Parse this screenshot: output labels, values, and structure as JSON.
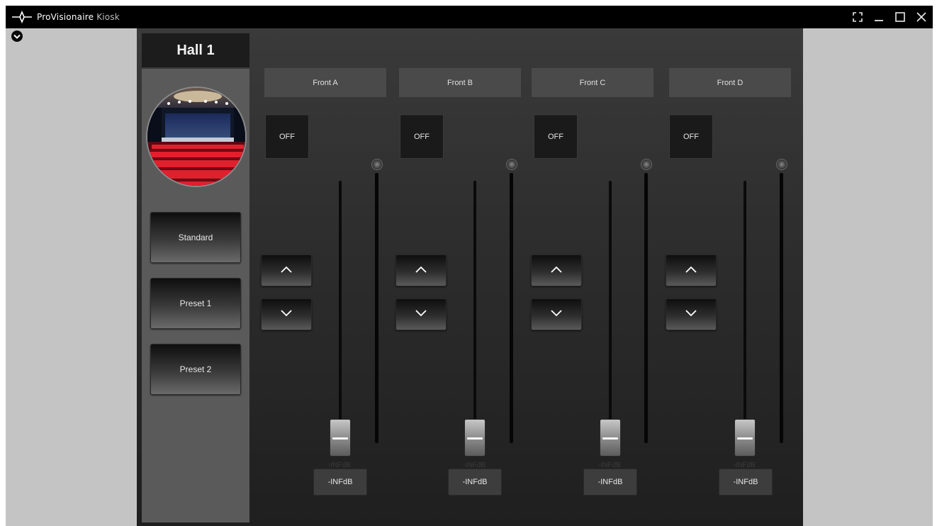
{
  "window": {
    "app_name": "ProVisionaire",
    "app_name_suffix": "Kiosk"
  },
  "hall": {
    "title": "Hall 1",
    "image_name": "theater-hall-photo"
  },
  "presets": [
    {
      "label": "Standard"
    },
    {
      "label": "Preset 1"
    },
    {
      "label": "Preset 2"
    }
  ],
  "channels": [
    {
      "name": "Front A",
      "mute_label": "OFF",
      "level_label": "-INFdB",
      "level_readout": "-INFdB",
      "fader_level": 0
    },
    {
      "name": "Front B",
      "mute_label": "OFF",
      "level_label": "-INFdB",
      "level_readout": "-INFdB",
      "fader_level": 0
    },
    {
      "name": "Front C",
      "mute_label": "OFF",
      "level_label": "-INFdB",
      "level_readout": "-INFdB",
      "fader_level": 0
    },
    {
      "name": "Front D",
      "mute_label": "OFF",
      "level_label": "-INFdB",
      "level_readout": "-INFdB",
      "fader_level": 0
    }
  ],
  "icons": {
    "app_logo": "provisionaire-logo-icon",
    "collapse": "chevron-down-circle-icon",
    "fullscreen": "fullscreen-icon",
    "minimize": "minimize-icon",
    "maximize": "maximize-icon",
    "close": "close-icon",
    "level_up": "chevron-up-icon",
    "level_down": "chevron-down-icon"
  },
  "colors": {
    "titlebar": "#000000",
    "background": "#c4c4c4",
    "panel": "#2e2e2e",
    "side_column": "#5a5a5a",
    "channel_header": "#4a4a4a",
    "text": "#e6e6e6"
  }
}
